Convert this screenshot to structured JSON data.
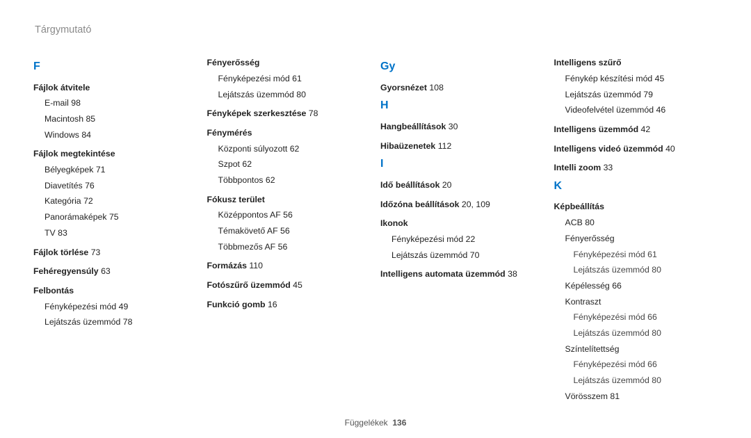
{
  "page_header": "Tárgymutató",
  "footer_label": "Függelékek",
  "footer_page": "136",
  "columns": [
    {
      "items": [
        {
          "type": "letter",
          "text": "F"
        },
        {
          "type": "head",
          "text": "Fájlok átvitele"
        },
        {
          "type": "sub",
          "label": "E-mail",
          "page": "98"
        },
        {
          "type": "sub",
          "label": "Macintosh",
          "page": "85"
        },
        {
          "type": "sub",
          "label": "Windows",
          "page": "84"
        },
        {
          "type": "head",
          "text": "Fájlok megtekintése"
        },
        {
          "type": "sub",
          "label": "Bélyegképek",
          "page": "71"
        },
        {
          "type": "sub",
          "label": "Diavetítés",
          "page": "76"
        },
        {
          "type": "sub",
          "label": "Kategória",
          "page": "72"
        },
        {
          "type": "sub",
          "label": "Panorámaképek",
          "page": "75"
        },
        {
          "type": "sub",
          "label": "TV",
          "page": "83"
        },
        {
          "type": "headpage",
          "text": "Fájlok törlése",
          "page": "73"
        },
        {
          "type": "headpage",
          "text": "Fehéregyensúly",
          "page": "63"
        },
        {
          "type": "head",
          "text": "Felbontás"
        },
        {
          "type": "sub",
          "label": "Fényképezési mód",
          "page": "49"
        },
        {
          "type": "sub",
          "label": "Lejátszás üzemmód",
          "page": "78"
        }
      ]
    },
    {
      "items": [
        {
          "type": "head",
          "text": "Fényerősség",
          "first": true
        },
        {
          "type": "sub",
          "label": "Fényképezési mód",
          "page": "61"
        },
        {
          "type": "sub",
          "label": "Lejátszás üzemmód",
          "page": "80"
        },
        {
          "type": "headpage",
          "text": "Fényképek szerkesztése",
          "page": "78"
        },
        {
          "type": "head",
          "text": "Fénymérés"
        },
        {
          "type": "sub",
          "label": "Központi súlyozott",
          "page": "62"
        },
        {
          "type": "sub",
          "label": "Szpot",
          "page": "62"
        },
        {
          "type": "sub",
          "label": "Többpontos",
          "page": "62"
        },
        {
          "type": "head",
          "text": "Fókusz terület"
        },
        {
          "type": "sub",
          "label": "Középpontos AF",
          "page": "56"
        },
        {
          "type": "sub",
          "label": "Témakövető AF",
          "page": "56"
        },
        {
          "type": "sub",
          "label": "Többmezős AF",
          "page": "56"
        },
        {
          "type": "headpage",
          "text": "Formázás",
          "page": "110"
        },
        {
          "type": "headpage",
          "text": "Fotószűrő üzemmód",
          "page": "45"
        },
        {
          "type": "headpage",
          "text": "Funkció gomb",
          "page": "16"
        }
      ]
    },
    {
      "items": [
        {
          "type": "letter",
          "text": "Gy"
        },
        {
          "type": "headpage",
          "text": "Gyorsnézet",
          "page": "108",
          "first": true
        },
        {
          "type": "letter",
          "text": "H"
        },
        {
          "type": "headpage",
          "text": "Hangbeállítások",
          "page": "30",
          "first": true
        },
        {
          "type": "headpage",
          "text": "Hibaüzenetek",
          "page": "112"
        },
        {
          "type": "letter",
          "text": "I"
        },
        {
          "type": "headpage",
          "text": "Idő beállítások",
          "page": "20",
          "first": true
        },
        {
          "type": "headpage",
          "text": "Időzóna beállítások",
          "page": "20, 109"
        },
        {
          "type": "head",
          "text": "Ikonok"
        },
        {
          "type": "sub",
          "label": "Fényképezési mód",
          "page": "22"
        },
        {
          "type": "sub",
          "label": "Lejátszás üzemmód",
          "page": "70"
        },
        {
          "type": "headpage",
          "text": "Intelligens automata üzemmód",
          "page": "38"
        }
      ]
    },
    {
      "items": [
        {
          "type": "head",
          "text": "Intelligens szűrő",
          "first": true
        },
        {
          "type": "sub",
          "label": "Fénykép készítési mód",
          "page": "45"
        },
        {
          "type": "sub",
          "label": "Lejátszás üzemmód",
          "page": "79"
        },
        {
          "type": "sub",
          "label": "Videofelvétel üzemmód",
          "page": "46"
        },
        {
          "type": "headpage",
          "text": "Intelligens üzemmód",
          "page": "42"
        },
        {
          "type": "headpage",
          "text": "Intelligens videó üzemmód",
          "page": "40"
        },
        {
          "type": "headpage",
          "text": "Intelli zoom",
          "page": "33"
        },
        {
          "type": "letter",
          "text": "K"
        },
        {
          "type": "head",
          "text": "Képbeállítás",
          "first": true
        },
        {
          "type": "sub",
          "label": "ACB",
          "page": "80"
        },
        {
          "type": "subhead",
          "label": "Fényerősség"
        },
        {
          "type": "sub2",
          "label": "Fényképezési mód",
          "page": "61"
        },
        {
          "type": "sub2",
          "label": "Lejátszás üzemmód",
          "page": "80"
        },
        {
          "type": "sub",
          "label": "Képélesség",
          "page": "66"
        },
        {
          "type": "subhead",
          "label": "Kontraszt"
        },
        {
          "type": "sub2",
          "label": "Fényképezési mód",
          "page": "66"
        },
        {
          "type": "sub2",
          "label": "Lejátszás üzemmód",
          "page": "80"
        },
        {
          "type": "subhead",
          "label": "Színtelítettség"
        },
        {
          "type": "sub2",
          "label": "Fényképezési mód",
          "page": "66"
        },
        {
          "type": "sub2",
          "label": "Lejátszás üzemmód",
          "page": "80"
        },
        {
          "type": "sub",
          "label": "Vörösszem",
          "page": "81"
        }
      ]
    }
  ]
}
